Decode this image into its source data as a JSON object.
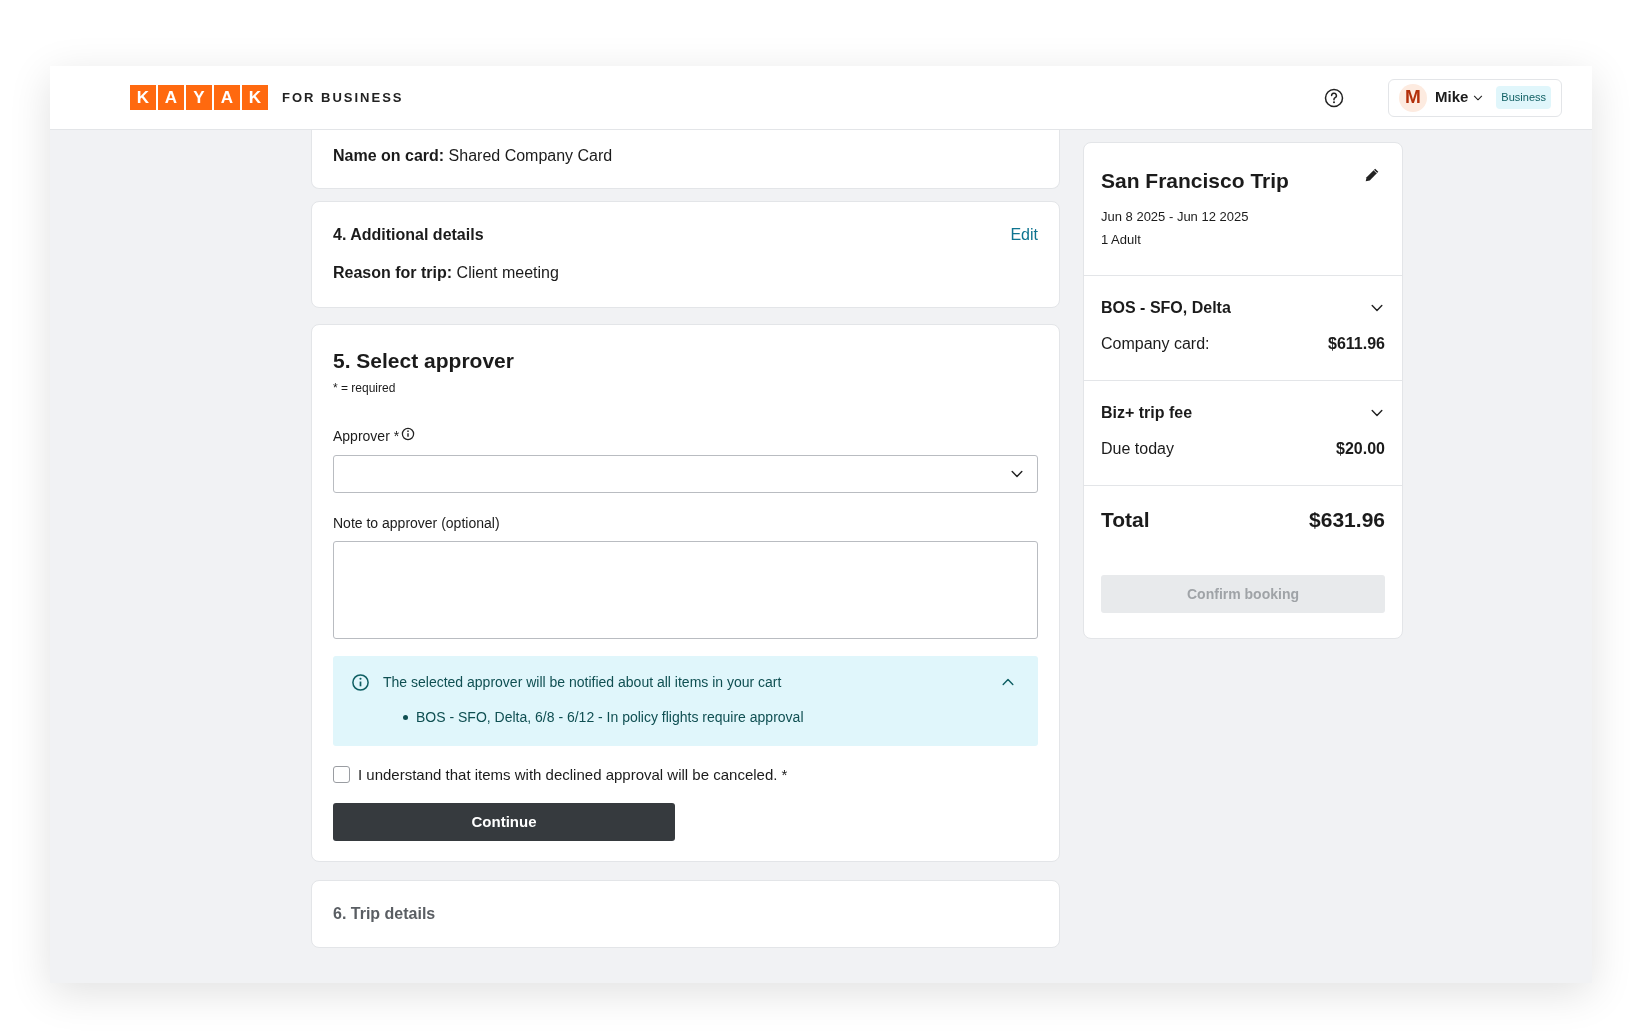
{
  "header": {
    "logo_letters": [
      "K",
      "A",
      "Y",
      "A",
      "K"
    ],
    "tagline": "FOR BUSINESS",
    "user": {
      "initial": "M",
      "name": "Mike",
      "badge": "Business"
    }
  },
  "payment": {
    "name_label": "Name on card:",
    "name_value": "Shared Company Card"
  },
  "additional": {
    "title": "4. Additional details",
    "edit": "Edit",
    "fields": [
      {
        "label": "Reason for trip:",
        "value": "Client meeting"
      }
    ]
  },
  "approver": {
    "title": "5. Select approver",
    "required_note": "* = required",
    "approver_label": "Approver *",
    "note_label": "Note to approver (optional)",
    "notice": {
      "text": "The selected approver will be notified about all items in your cart",
      "expanded": true,
      "items": [
        "BOS - SFO, Delta, 6/8 - 6/12 - In policy flights require approval"
      ]
    },
    "acknowledge": {
      "label": "I understand that items with declined approval will be canceled. *",
      "checked": false
    },
    "button": "Continue"
  },
  "trip_details": {
    "title": "6. Trip details"
  },
  "summary": {
    "title": "San Francisco Trip",
    "dates": "Jun 8 2025 - Jun 12 2025",
    "travelers": "1 Adult",
    "items": [
      {
        "title": "BOS - SFO, Delta",
        "label": "Company card:",
        "amount": "$611.96"
      },
      {
        "title": "Biz+ trip fee",
        "label": "Due today",
        "amount": "$20.00"
      }
    ],
    "total_label": "Total",
    "total": "$631.96",
    "confirm": {
      "label": "Confirm booking",
      "disabled": true
    }
  }
}
